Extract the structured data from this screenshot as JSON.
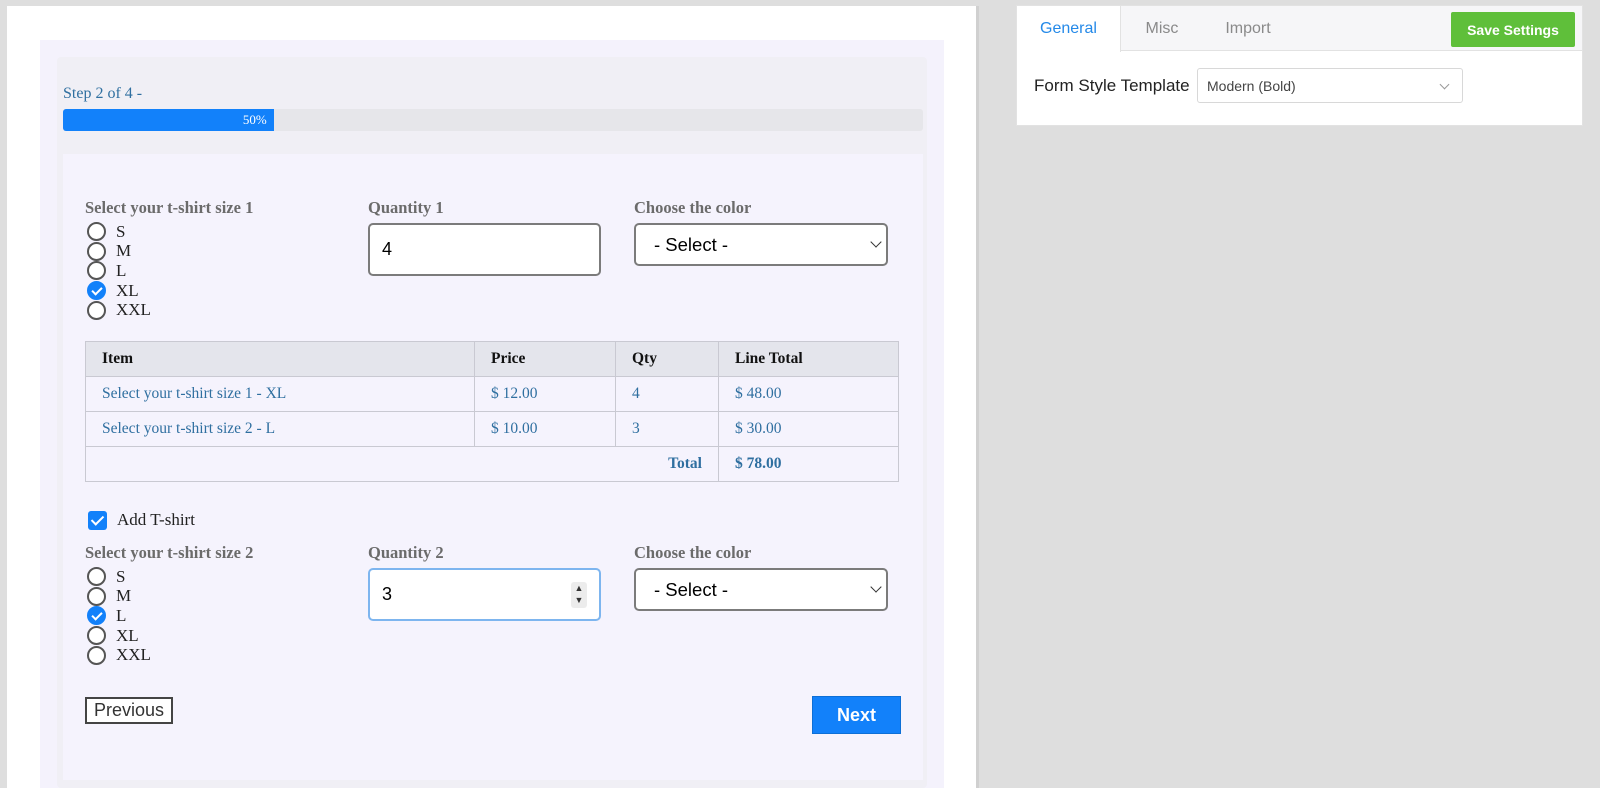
{
  "form": {
    "step_text": "Step 2 of 4 -",
    "progress_percent": 50,
    "progress_label": "50%",
    "section1": {
      "size_label": "Select your t-shirt size 1",
      "sizes": [
        "S",
        "M",
        "L",
        "XL",
        "XXL"
      ],
      "selected_size": "XL",
      "quantity_label": "Quantity 1",
      "quantity_value": "4",
      "color_label": "Choose the color",
      "color_value": "- Select -"
    },
    "summary_table": {
      "headers": [
        "Item",
        "Price",
        "Qty",
        "Line Total"
      ],
      "rows": [
        [
          "Select your t-shirt size 1 - XL",
          "$ 12.00",
          "4",
          "$ 48.00"
        ],
        [
          "Select your t-shirt size 2 - L",
          "$ 10.00",
          "3",
          "$ 30.00"
        ]
      ],
      "total_label": "Total",
      "total_value": "$ 78.00"
    },
    "add_tshirt_label": "Add T-shirt",
    "add_tshirt_checked": true,
    "section2": {
      "size_label": "Select your t-shirt size 2",
      "sizes": [
        "S",
        "M",
        "L",
        "XL",
        "XXL"
      ],
      "selected_size": "L",
      "quantity_label": "Quantity 2",
      "quantity_value": "3",
      "color_label": "Choose the color",
      "color_value": "- Select -"
    },
    "prev_label": "Previous",
    "next_label": "Next"
  },
  "settings": {
    "tabs": [
      "General",
      "Misc",
      "Import"
    ],
    "active_tab": "General",
    "save_label": "Save Settings",
    "template_label": "Form Style Template",
    "template_value": "Modern (Bold)"
  },
  "colors": {
    "accent": "#1281fa",
    "save_green": "#5fbf3a",
    "link_blue": "#2f6fa0",
    "tab_active": "#2489e8"
  },
  "icons": {
    "radio_checked": "check-circle-icon",
    "checkbox_checked": "check-icon",
    "dropdown": "chevron-down-icon",
    "spinner": "spin-arrows-icon"
  }
}
